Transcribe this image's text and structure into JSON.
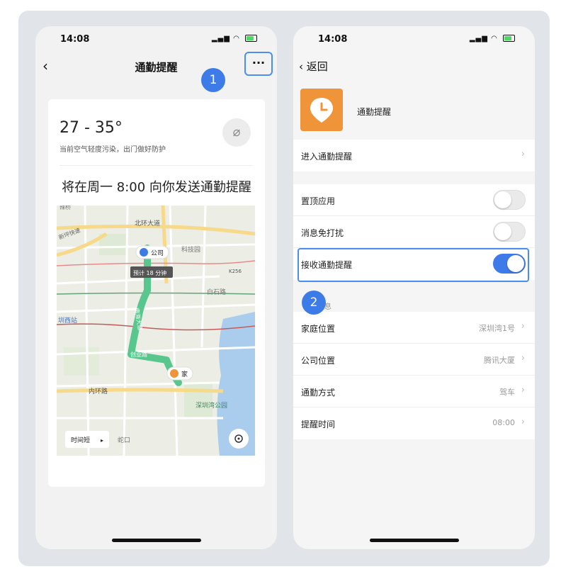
{
  "left_phone": {
    "status_time": "14:08",
    "nav_title": "通勤提醒",
    "more_label": "···",
    "weather": {
      "temp_range": "27 - 35°",
      "air_quality": "当前空气轻度污染，出门做好防护"
    },
    "notice": "将在周一 8:00 向你发送通勤提醒",
    "map": {
      "labels": {
        "road_north": "北环大道",
        "company": "公司",
        "tech_park": "科技园",
        "eta": "预计 18 分钟",
        "baishi": "白石路",
        "station": "圳西站",
        "chuangye": "创业路",
        "home": "家",
        "inner_ring": "内环路",
        "bay_park": "深圳湾公园",
        "shekou": "蛇口",
        "highway": "K256",
        "nanhai": "南海大道",
        "top_left": "新坪快速",
        "top_corner": "辣桥"
      },
      "route_button": "时间短",
      "locate_icon": "locate-icon"
    }
  },
  "right_phone": {
    "status_time": "14:08",
    "back_label": "返回",
    "app_name": "通勤提醒",
    "enter_row": "进入通勤提醒",
    "toggles": [
      {
        "label": "置顶应用",
        "on": false
      },
      {
        "label": "消息免打扰",
        "on": false
      },
      {
        "label": "接收通勤提醒",
        "on": true
      }
    ],
    "info_section_label": "息",
    "info_rows": [
      {
        "label": "家庭位置",
        "value": "深圳湾1号"
      },
      {
        "label": "公司位置",
        "value": "腾讯大厦"
      },
      {
        "label": "通勤方式",
        "value": "驾车"
      },
      {
        "label": "提醒时间",
        "value": "08:00"
      }
    ]
  },
  "badges": [
    "1",
    "2"
  ],
  "colors": {
    "accent": "#3d7be8",
    "route": "#58c68d",
    "app_icon": "#f0943a",
    "highlight": "#4a8ef0"
  }
}
